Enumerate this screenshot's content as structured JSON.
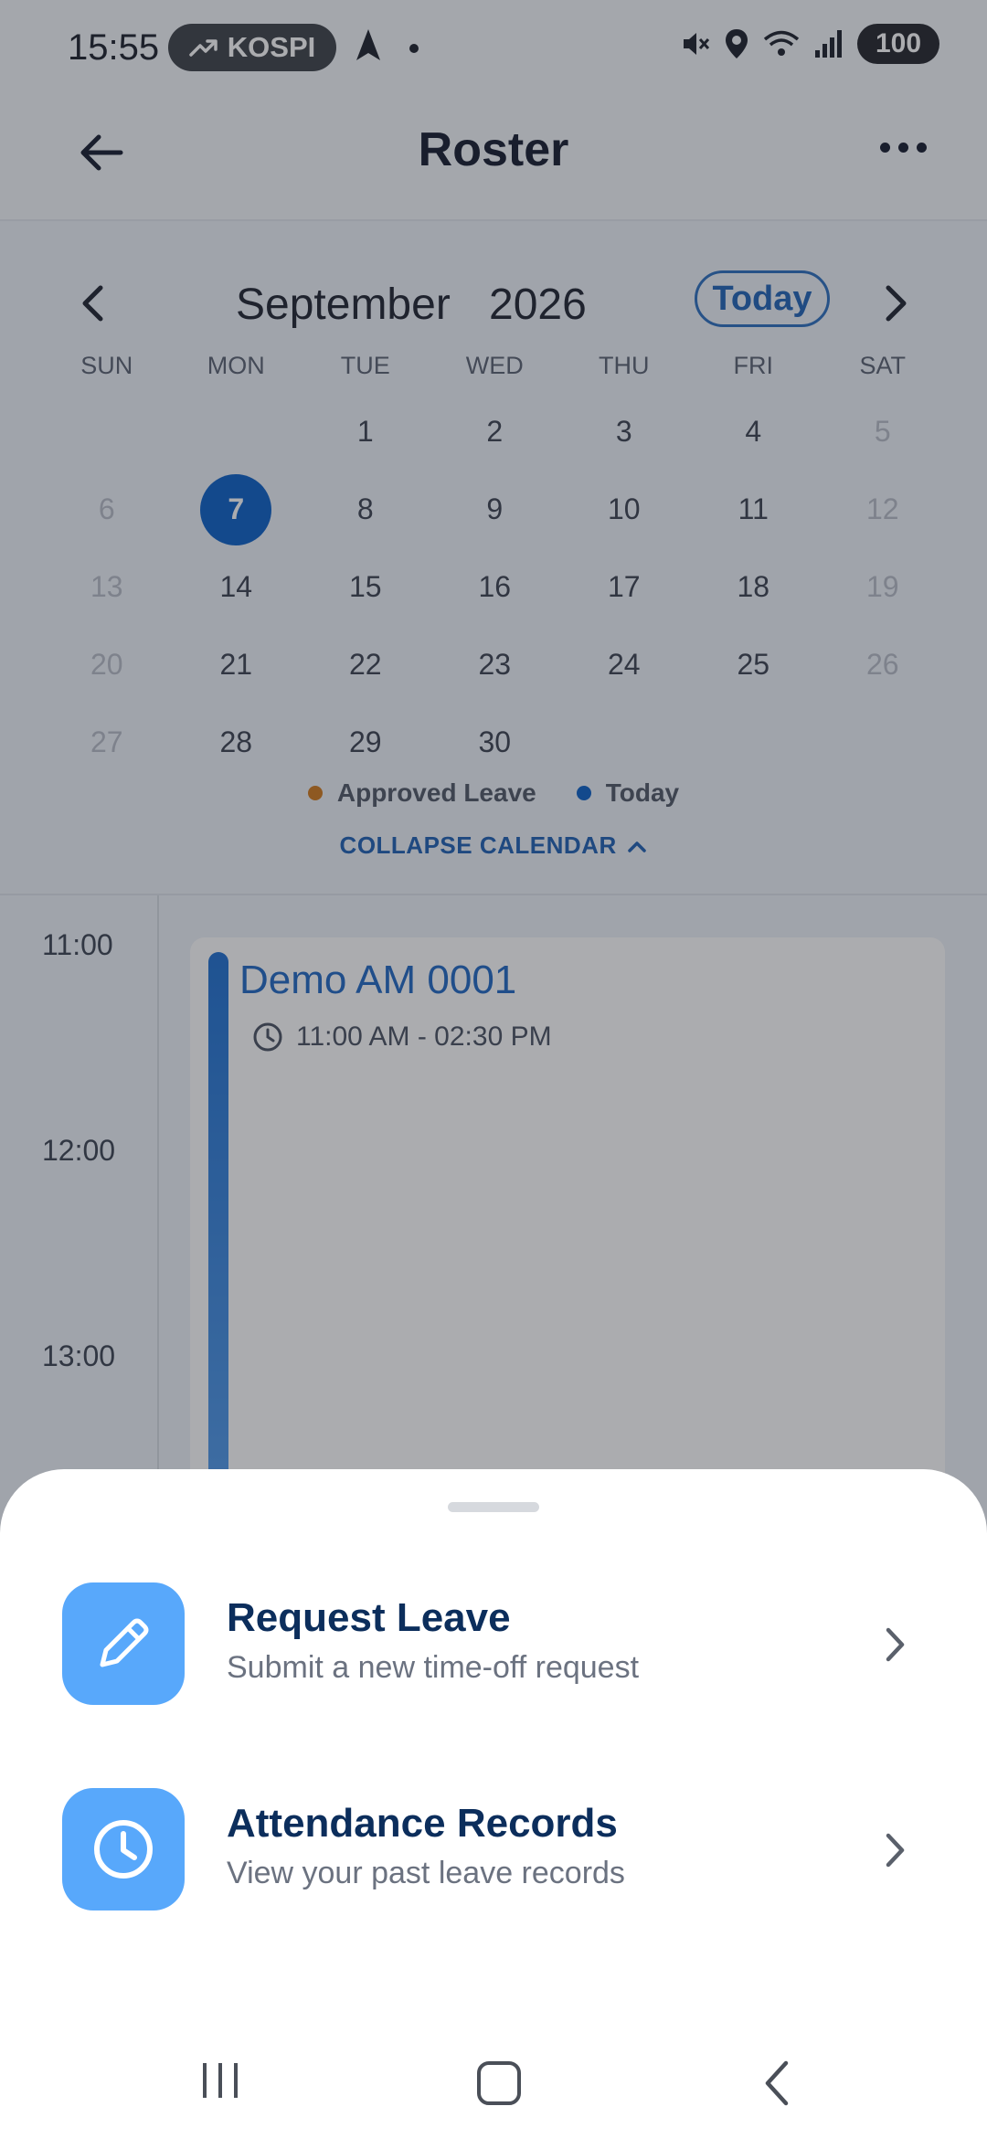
{
  "status_bar": {
    "time": "15:55",
    "ticker": "KOSPI",
    "battery": "100"
  },
  "header": {
    "title": "Roster"
  },
  "calendar": {
    "month": "September",
    "year": "2026",
    "today_label": "Today",
    "weekdays": [
      "SUN",
      "MON",
      "TUE",
      "WED",
      "THU",
      "FRI",
      "SAT"
    ],
    "days": [
      {
        "d": "",
        "m": 0
      },
      {
        "d": "",
        "m": 0
      },
      {
        "d": "1",
        "m": 0
      },
      {
        "d": "2",
        "m": 0
      },
      {
        "d": "3",
        "m": 0
      },
      {
        "d": "4",
        "m": 0
      },
      {
        "d": "5",
        "m": 1
      },
      {
        "d": "6",
        "m": 1
      },
      {
        "d": "7",
        "m": 0,
        "sel": 1
      },
      {
        "d": "8",
        "m": 0
      },
      {
        "d": "9",
        "m": 0
      },
      {
        "d": "10",
        "m": 0
      },
      {
        "d": "11",
        "m": 0
      },
      {
        "d": "12",
        "m": 1
      },
      {
        "d": "13",
        "m": 1
      },
      {
        "d": "14",
        "m": 0
      },
      {
        "d": "15",
        "m": 0
      },
      {
        "d": "16",
        "m": 0
      },
      {
        "d": "17",
        "m": 0
      },
      {
        "d": "18",
        "m": 0
      },
      {
        "d": "19",
        "m": 1
      },
      {
        "d": "20",
        "m": 1
      },
      {
        "d": "21",
        "m": 0
      },
      {
        "d": "22",
        "m": 0
      },
      {
        "d": "23",
        "m": 0
      },
      {
        "d": "24",
        "m": 0
      },
      {
        "d": "25",
        "m": 0
      },
      {
        "d": "26",
        "m": 1
      },
      {
        "d": "27",
        "m": 1
      },
      {
        "d": "28",
        "m": 0
      },
      {
        "d": "29",
        "m": 0
      },
      {
        "d": "30",
        "m": 0
      },
      {
        "d": "",
        "m": 0
      },
      {
        "d": "",
        "m": 0
      },
      {
        "d": "",
        "m": 0
      }
    ],
    "legend": [
      {
        "label": "Approved Leave",
        "color": "#d07a1c"
      },
      {
        "label": "Today",
        "color": "#0a5fc7"
      }
    ],
    "collapse_label": "COLLAPSE CALENDAR"
  },
  "timeline": {
    "hours": [
      "11:00",
      "12:00",
      "13:00"
    ],
    "event": {
      "title": "Demo AM 0001",
      "time": "11:00 AM - 02:30 PM"
    }
  },
  "sheet": {
    "actions": [
      {
        "title": "Request Leave",
        "subtitle": "Submit a new time-off request",
        "icon": "pencil-icon"
      },
      {
        "title": "Attendance Records",
        "subtitle": "View your past leave records",
        "icon": "clock-icon"
      }
    ]
  }
}
